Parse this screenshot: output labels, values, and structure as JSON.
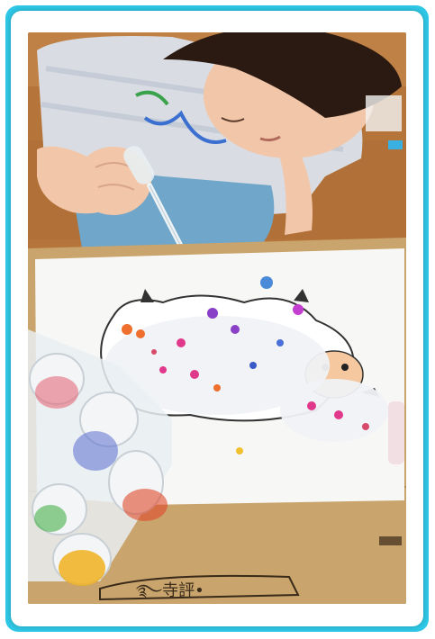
{
  "photo": {
    "alt": "",
    "scene_colors": {
      "frame_accent": "#2ec8e6",
      "floor": "#b5743a",
      "cardboard": "#c9a46c",
      "paper": "#f7f7f5",
      "shirt": "#d9dde3",
      "pants": "#6fa6c9",
      "skin": "#f2c6a8",
      "hair": "#2b1a12"
    },
    "box_print": "࿐寺評•"
  }
}
